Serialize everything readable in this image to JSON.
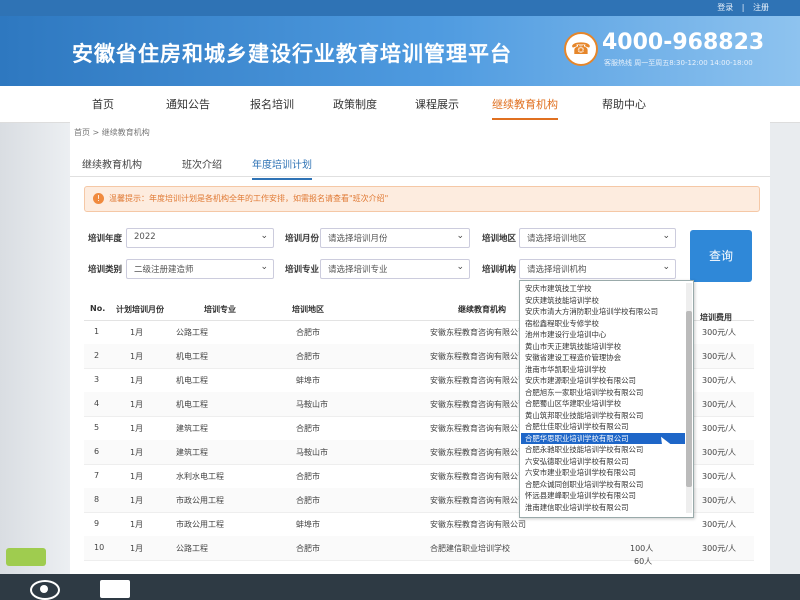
{
  "top_links": {
    "login": "登录",
    "sep": "|",
    "logout": "注册"
  },
  "site_title": "安徽省住房和城乡建设行业教育培训管理平台",
  "hotline": {
    "number": "4000-968823",
    "hours": "客服热线 周一至周五8:30-12:00 14:00-18:00"
  },
  "nav": [
    {
      "label": "首页"
    },
    {
      "label": "通知公告"
    },
    {
      "label": "报名培训"
    },
    {
      "label": "政策制度"
    },
    {
      "label": "课程展示"
    },
    {
      "label": "继续教育机构",
      "active": true
    },
    {
      "label": "帮助中心"
    }
  ],
  "breadcrumb": "首页 > 继续教育机构",
  "tabs": [
    {
      "label": "继续教育机构"
    },
    {
      "label": "班次介绍"
    },
    {
      "label": "年度培训计划",
      "active": true
    }
  ],
  "notice": "温馨提示：年度培训计划是各机构全年的工作安排，如需报名请查看\"班次介绍\"",
  "filters": {
    "year_label": "培训年度",
    "year_value": "2022",
    "month_label": "培训月份",
    "month_value": "请选择培训月份",
    "region_label": "培训地区",
    "region_value": "请选择培训地区",
    "category_label": "培训类别",
    "category_value": "二级注册建造师",
    "major_label": "培训专业",
    "major_value": "请选择培训专业",
    "org_label": "培训机构",
    "org_value": "请选择培训机构"
  },
  "search_button": "查询",
  "table": {
    "headers": [
      "No.",
      "计划培训月份",
      "培训专业",
      "培训地区",
      "继续教育机构",
      "培训费用"
    ],
    "rows": [
      {
        "no": "1",
        "month": "1月",
        "major": "公路工程",
        "region": "合肥市",
        "org": "安徽东程教育咨询有限公司",
        "count": "",
        "fee": "300元/人"
      },
      {
        "no": "2",
        "month": "1月",
        "major": "机电工程",
        "region": "合肥市",
        "org": "安徽东程教育咨询有限公司",
        "count": "",
        "fee": "300元/人"
      },
      {
        "no": "3",
        "month": "1月",
        "major": "机电工程",
        "region": "蚌埠市",
        "org": "安徽东程教育咨询有限公司",
        "count": "",
        "fee": "300元/人"
      },
      {
        "no": "4",
        "month": "1月",
        "major": "机电工程",
        "region": "马鞍山市",
        "org": "安徽东程教育咨询有限公司",
        "count": "",
        "fee": "300元/人"
      },
      {
        "no": "5",
        "month": "1月",
        "major": "建筑工程",
        "region": "合肥市",
        "org": "安徽东程教育咨询有限公司",
        "count": "",
        "fee": "300元/人"
      },
      {
        "no": "6",
        "month": "1月",
        "major": "建筑工程",
        "region": "马鞍山市",
        "org": "安徽东程教育咨询有限公司",
        "count": "",
        "fee": "300元/人"
      },
      {
        "no": "7",
        "month": "1月",
        "major": "水利水电工程",
        "region": "合肥市",
        "org": "安徽东程教育咨询有限公司",
        "count": "",
        "fee": "300元/人"
      },
      {
        "no": "8",
        "month": "1月",
        "major": "市政公用工程",
        "region": "合肥市",
        "org": "安徽东程教育咨询有限公司",
        "count": "",
        "fee": "300元/人"
      },
      {
        "no": "9",
        "month": "1月",
        "major": "市政公用工程",
        "region": "蚌埠市",
        "org": "安徽东程教育咨询有限公司",
        "count": "",
        "fee": "300元/人"
      },
      {
        "no": "10",
        "month": "1月",
        "major": "公路工程",
        "region": "合肥市",
        "org": "合肥建信职业培训学校",
        "count": "100人",
        "fee": "300元/人"
      }
    ],
    "extra_count": "60人"
  },
  "org_dropdown": {
    "items": [
      "安庆市建筑技工学校",
      "安庆建筑技能培训学校",
      "安庆市清大方消防职业培训学校有限公司",
      "宿松鑫程职业专修学校",
      "池州市建设行业培训中心",
      "黄山市天正建筑技能培训学校",
      "安徽省建设工程造价管理协会",
      "淮南市华凯职业培训学校",
      "安庆市建源职业培训学校有限公司",
      "合肥旭东一家职业培训学校有限公司",
      "合肥蜀山区华建职业培训学校",
      "黄山筑邦职业技能培训学校有限公司",
      "合肥仕佳职业培训学校有限公司",
      "合肥华思职业培训学校有限公司",
      "合肥永驰职业技能培训学校有限公司",
      "六安弘德职业培训学校有限公司",
      "六安市建业职业培训学校有限公司",
      "合肥众诚同创职业培训学校有限公司",
      "怀远县建峰职业培训学校有限公司",
      "淮南建信职业培训学校有限公司"
    ],
    "selected_index": 13
  }
}
